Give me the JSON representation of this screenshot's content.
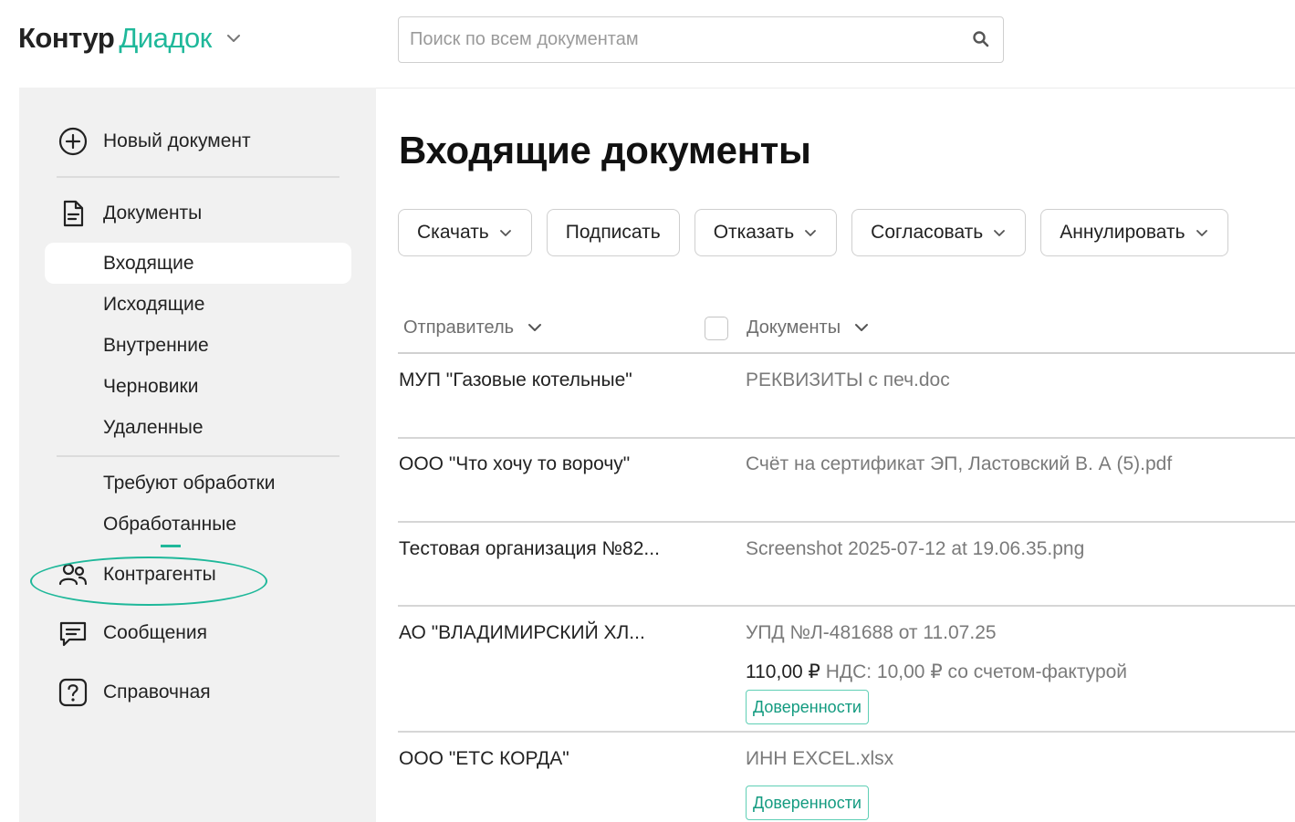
{
  "header": {
    "brand": "Контур",
    "product": "Диадок",
    "search_placeholder": "Поиск по всем документам"
  },
  "sidebar": {
    "new_document": "Новый документ",
    "documents": "Документы",
    "sub_items": [
      "Входящие",
      "Исходящие",
      "Внутренние",
      "Черновики",
      "Удаленные"
    ],
    "status_items": [
      "Требуют обработки",
      "Обработанные"
    ],
    "counterparties": "Контрагенты",
    "messages": "Сообщения",
    "help": "Справочная"
  },
  "main": {
    "title": "Входящие документы",
    "actions": [
      "Скачать",
      "Подписать",
      "Отказать",
      "Согласовать",
      "Аннулировать"
    ],
    "columns": {
      "sender": "Отправитель",
      "documents": "Документы"
    },
    "rows": [
      {
        "sender": "МУП \"Газовые котельные\"",
        "document": "РЕКВИЗИТЫ с печ.doc"
      },
      {
        "sender": "ООО \"Что хочу то ворочу\"",
        "document": "Счёт на сертификат ЭП, Ластовский В. А (5).pdf"
      },
      {
        "sender": "Тестовая организация №82...",
        "document": "Screenshot 2025-07-12 at 19.06.35.png"
      },
      {
        "sender": "АО \"ВЛАДИМИРСКИЙ ХЛ...",
        "document": "УПД №Л-481688 от 11.07.25",
        "amount": "110,00 ₽",
        "vat": " НДС: 10,00 ₽ со счетом-фактурой",
        "badge": "Доверенности"
      },
      {
        "sender": "ООО \"ЕТС КОРДА\"",
        "document": "ИНН EXCEL.xlsx",
        "badge": "Доверенности"
      }
    ]
  },
  "colors": {
    "accent": "#1fb89a",
    "sidebar_bg": "#f1f1f1"
  }
}
